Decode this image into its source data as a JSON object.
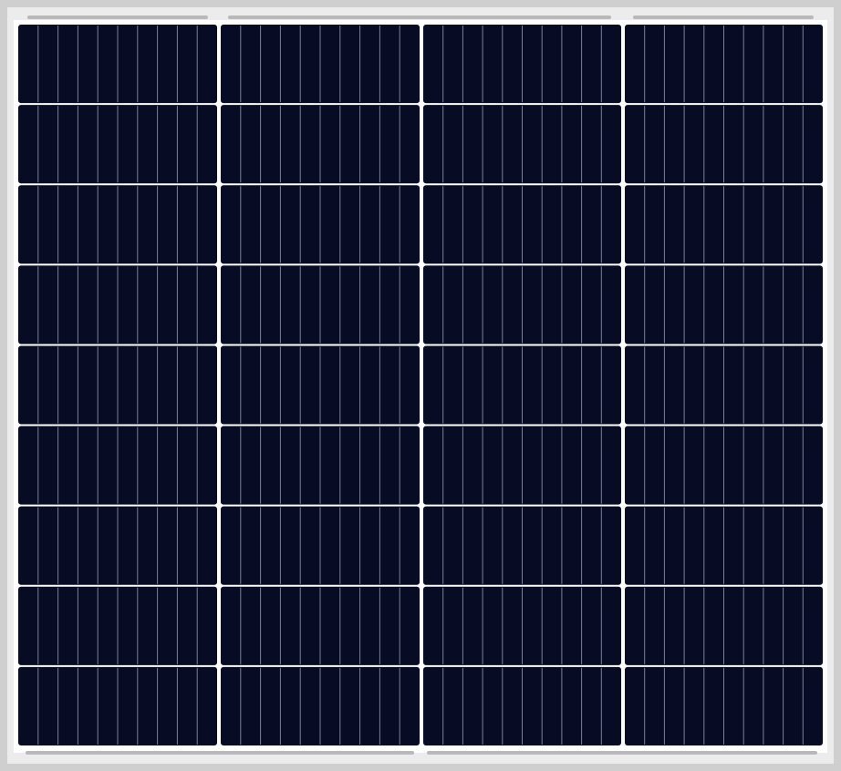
{
  "image": {
    "subject": "solar-panel",
    "layout": {
      "columns": 4,
      "rows": 9,
      "busbars_per_cell": 10,
      "cell_type": "monocrystalline half-cut"
    },
    "colors": {
      "frame_outer": "#cfcfcf",
      "frame_inner": "#ececec",
      "backsheet": "#ffffff",
      "cell": "#070c24",
      "busbar": "#7d8196",
      "frame_highlight": "#b9b9b9"
    }
  }
}
